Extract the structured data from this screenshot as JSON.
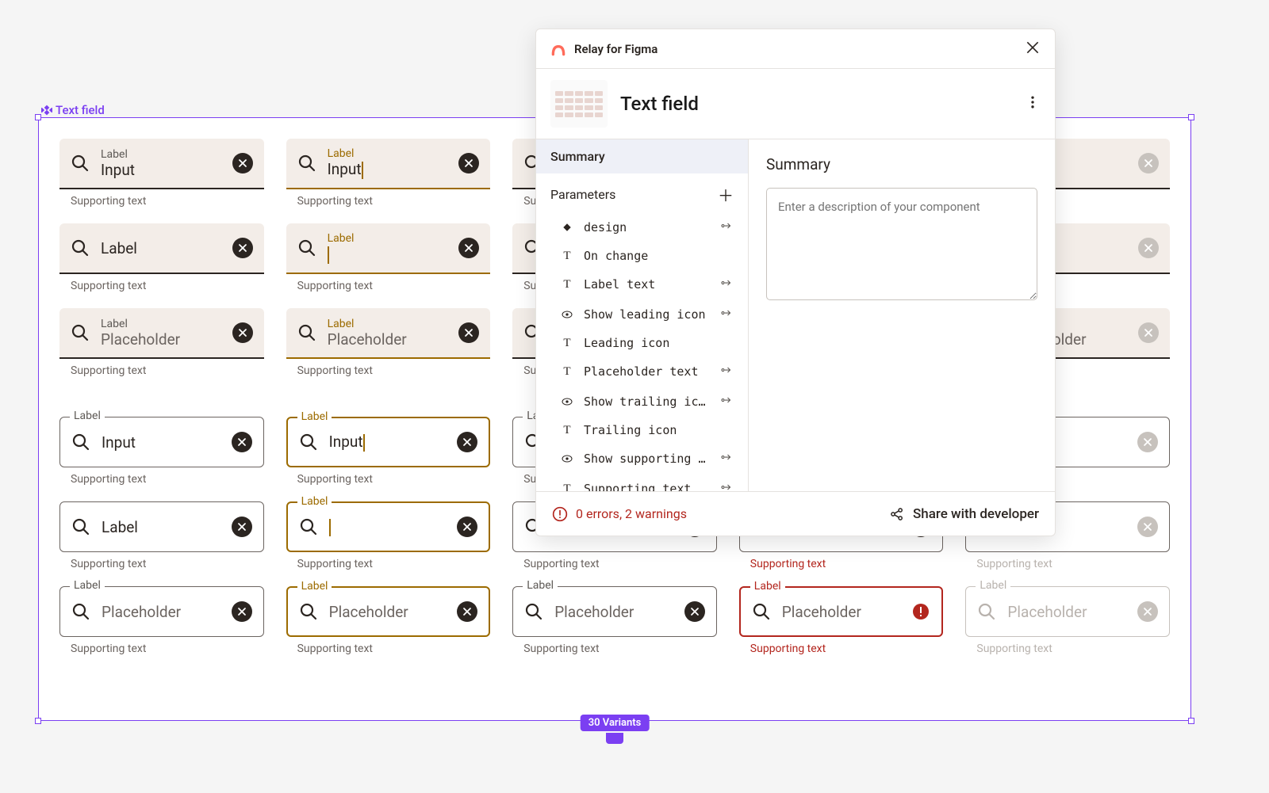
{
  "frame": {
    "label": "Text field",
    "variants_badge": "30 Variants"
  },
  "strings": {
    "label": "Label",
    "input": "Input",
    "placeholder": "Placeholder",
    "supporting": "Supporting text"
  },
  "panel": {
    "title": "Relay for Figma",
    "component_name": "Text field",
    "sidebar": {
      "summary": "Summary",
      "parameters_header": "Parameters",
      "parameters": [
        {
          "icon": "diamond",
          "name": "design",
          "action": true
        },
        {
          "icon": "T",
          "name": "On change",
          "action": false
        },
        {
          "icon": "T",
          "name": "Label text",
          "action": true
        },
        {
          "icon": "eye",
          "name": "Show leading icon",
          "action": true
        },
        {
          "icon": "T",
          "name": "Leading icon",
          "action": false
        },
        {
          "icon": "T",
          "name": "Placeholder text",
          "action": true
        },
        {
          "icon": "eye",
          "name": "Show trailing icon",
          "action": true
        },
        {
          "icon": "T",
          "name": "Trailing icon",
          "action": false
        },
        {
          "icon": "eye",
          "name": "Show supporting t…",
          "action": true
        },
        {
          "icon": "T",
          "name": "Supporting text",
          "action": true
        }
      ]
    },
    "content": {
      "heading": "Summary",
      "description_placeholder": "Enter a description of your component"
    },
    "footer": {
      "status": "0 errors, 2 warnings",
      "share": "Share with developer"
    }
  }
}
